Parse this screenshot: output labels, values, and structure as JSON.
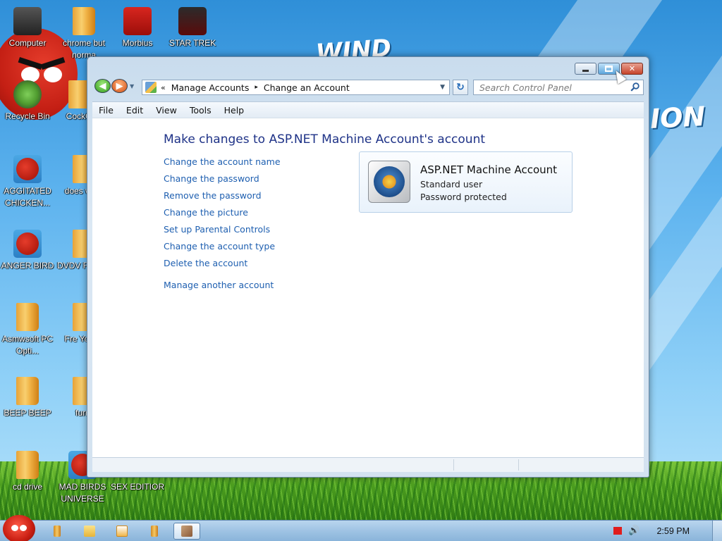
{
  "desktop": {
    "icons": [
      {
        "label": "Computer",
        "icon": "computer-icon"
      },
      {
        "label": "chrome but norma",
        "icon": "folder-icon"
      },
      {
        "label": "Morbius",
        "icon": "pdf-icon"
      },
      {
        "label": "STAR TREK",
        "icon": "star-trek-icon"
      },
      {
        "label": "Recycle Bin",
        "icon": "recycle-bin-icon"
      },
      {
        "label": "CockCl",
        "icon": "folder-icon"
      },
      {
        "label": "AGGITATED CHICKEN...",
        "icon": "angry-bird-icon"
      },
      {
        "label": "does work",
        "icon": "folder-icon"
      },
      {
        "label": "ANGER BIRD",
        "icon": "angry-bird-icon"
      },
      {
        "label": "DVDV Free St",
        "icon": "folder-icon"
      },
      {
        "label": "Asmwsoft PC Opti...",
        "icon": "folder-icon"
      },
      {
        "label": "Fre YouTu",
        "icon": "folder-icon"
      },
      {
        "label": "BEEP BEEP",
        "icon": "folder-icon"
      },
      {
        "label": "furry",
        "icon": "folder-icon"
      },
      {
        "label": "cd drive",
        "icon": "folder-icon"
      },
      {
        "label": "MAD BIRDS UNIVERSE",
        "icon": "angry-bird-icon"
      },
      {
        "label": "SEX EDITIOR",
        "icon": "folder-icon"
      }
    ]
  },
  "window": {
    "breadcrumb": {
      "overflow": "«",
      "items": [
        "Manage Accounts",
        "Change an Account"
      ],
      "separator": "▸"
    },
    "search_placeholder": "Search Control Panel",
    "menu": [
      "File",
      "Edit",
      "View",
      "Tools",
      "Help"
    ],
    "page_title": "Make changes to ASP.NET Machine Account's account",
    "tasks": [
      "Change the account name",
      "Change the password",
      "Remove the password",
      "Change the picture",
      "Set up Parental Controls",
      "Change the account type",
      "Delete the account"
    ],
    "extra_task": "Manage another account",
    "account": {
      "name": "ASP.NET Machine Account",
      "type": "Standard user",
      "status": "Password protected"
    }
  },
  "taskbar": {
    "clock": "2:59 PM",
    "buttons": [
      "folder-icon",
      "folder-open-icon",
      "media-player-icon",
      "folder-icon",
      "control-panel-icon"
    ]
  },
  "colors": {
    "link": "#1e5fb0",
    "title": "#1e3287"
  }
}
